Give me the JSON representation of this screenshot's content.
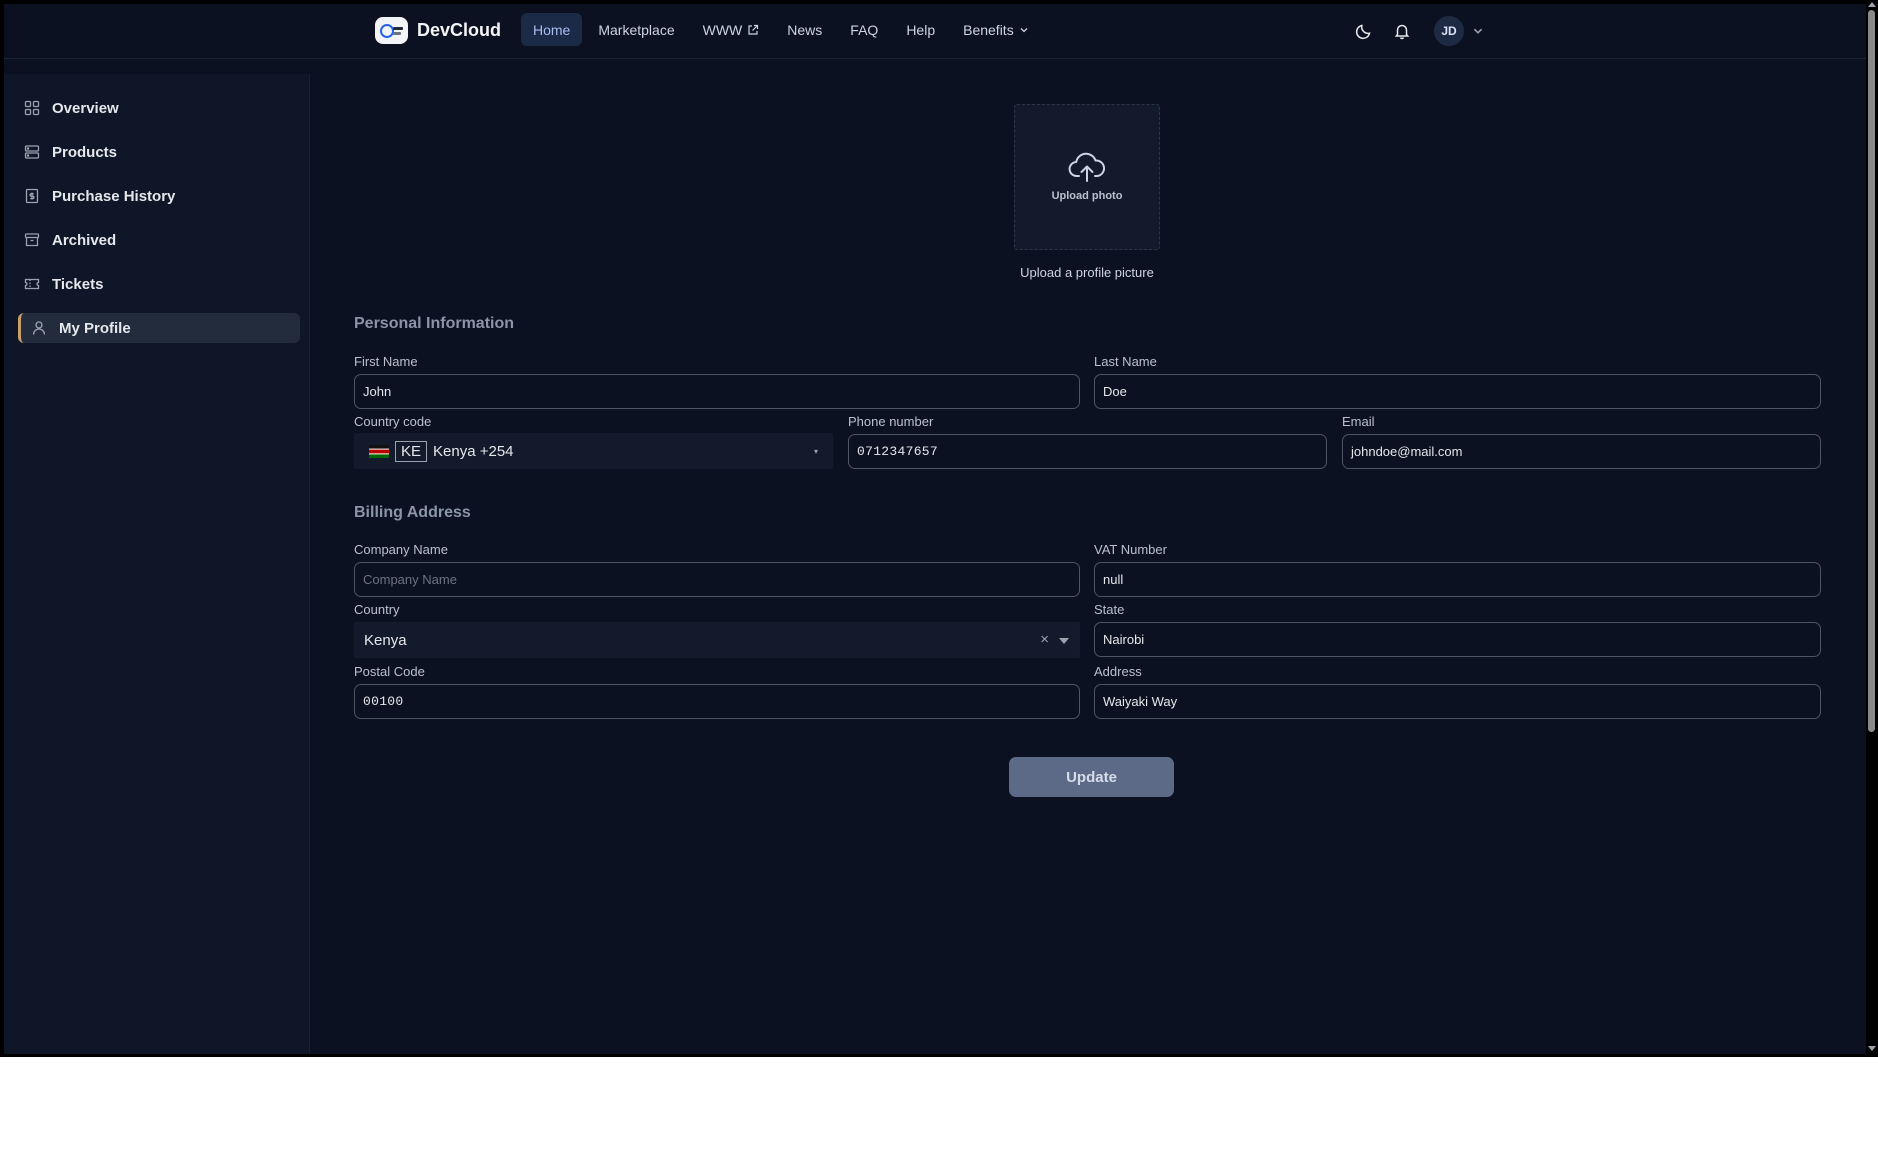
{
  "header": {
    "brand_name": "DevCloud",
    "nav": [
      {
        "label": "Home",
        "active": true
      },
      {
        "label": "Marketplace"
      },
      {
        "label": "WWW",
        "icon": "external-link-icon"
      },
      {
        "label": "News"
      },
      {
        "label": "FAQ"
      },
      {
        "label": "Help"
      },
      {
        "label": "Benefits",
        "icon": "chevron-down-icon"
      }
    ],
    "user_initials": "JD"
  },
  "sidebar": {
    "items": [
      {
        "label": "Overview",
        "icon": "grid-icon"
      },
      {
        "label": "Products",
        "icon": "server-icon"
      },
      {
        "label": "Purchase History",
        "icon": "receipt-icon"
      },
      {
        "label": "Archived",
        "icon": "archive-icon"
      },
      {
        "label": "Tickets",
        "icon": "ticket-icon"
      },
      {
        "label": "My Profile",
        "icon": "user-icon",
        "active": true
      }
    ]
  },
  "profile": {
    "upload_label": "Upload photo",
    "upload_caption": "Upload a profile picture",
    "personal_title": "Personal Information",
    "first_name": {
      "label": "First Name",
      "value": "John"
    },
    "last_name": {
      "label": "Last Name",
      "value": "Doe"
    },
    "country_code": {
      "label": "Country code",
      "iso": "KE",
      "text": "Kenya +254",
      "arrow": "▾"
    },
    "phone": {
      "label": "Phone number",
      "value": "0712347657"
    },
    "email": {
      "label": "Email",
      "value": "johndoe@mail.com"
    },
    "billing_title": "Billing Address",
    "company_name": {
      "label": "Company Name",
      "placeholder": "Company Name"
    },
    "vat_number": {
      "label": "VAT Number",
      "value": "null"
    },
    "country": {
      "label": "Country",
      "value": "Kenya",
      "clear": "×"
    },
    "state": {
      "label": "State",
      "value": "Nairobi"
    },
    "postal_code": {
      "label": "Postal Code",
      "value": "00100"
    },
    "address": {
      "label": "Address",
      "value": "Waiyaki Way"
    },
    "update_label": "Update"
  },
  "colors": {
    "background": "#0b1120",
    "sidebar": "#0e1628",
    "nav_active": "#1b2a47",
    "button": "#5c6a88",
    "active_accent": "#c8a06a"
  }
}
